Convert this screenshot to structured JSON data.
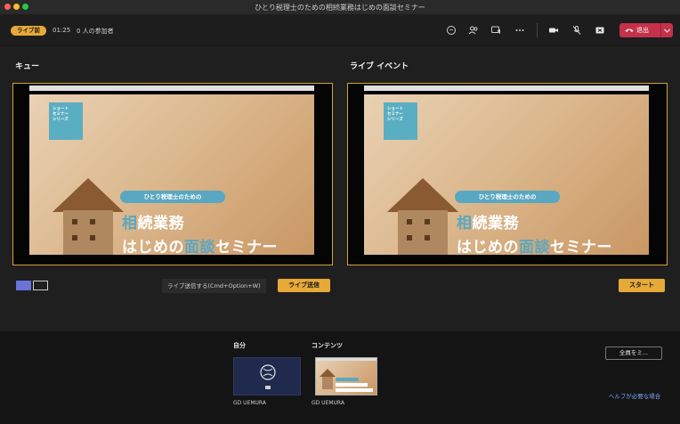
{
  "window": {
    "title": "ひとり税理士のための相続業務はじめの面談セミナー"
  },
  "topbar": {
    "status": "ライブ前",
    "timer": "01:25",
    "attendees": "0 人の参加者",
    "leave_label": "退出"
  },
  "queue": {
    "label": "キュー",
    "send_hint": "ライブ送信する(Cmd+Option+W)",
    "send_button": "ライブ送信"
  },
  "live": {
    "label": "ライブ イベント",
    "start_button": "スタート"
  },
  "slide": {
    "series": [
      "ショート",
      "セミナー",
      "シリーズ"
    ],
    "banner": "ひとり税理士のための",
    "line1_a": "相",
    "line1_b": "続業務",
    "line2_a": "はじめの",
    "line2_b": "面談",
    "line2_c": "セミナー"
  },
  "bottom": {
    "self_label": "自分",
    "content_label": "コンテンツ",
    "self_name": "GD UEMURA",
    "content_name": "GD UEMURA",
    "mute_all": "全員をミ...",
    "help": "ヘルプが必要な場合"
  },
  "colors": {
    "accent": "#e7a93a",
    "leave": "#c4314b",
    "brand": "#6b72d9"
  }
}
